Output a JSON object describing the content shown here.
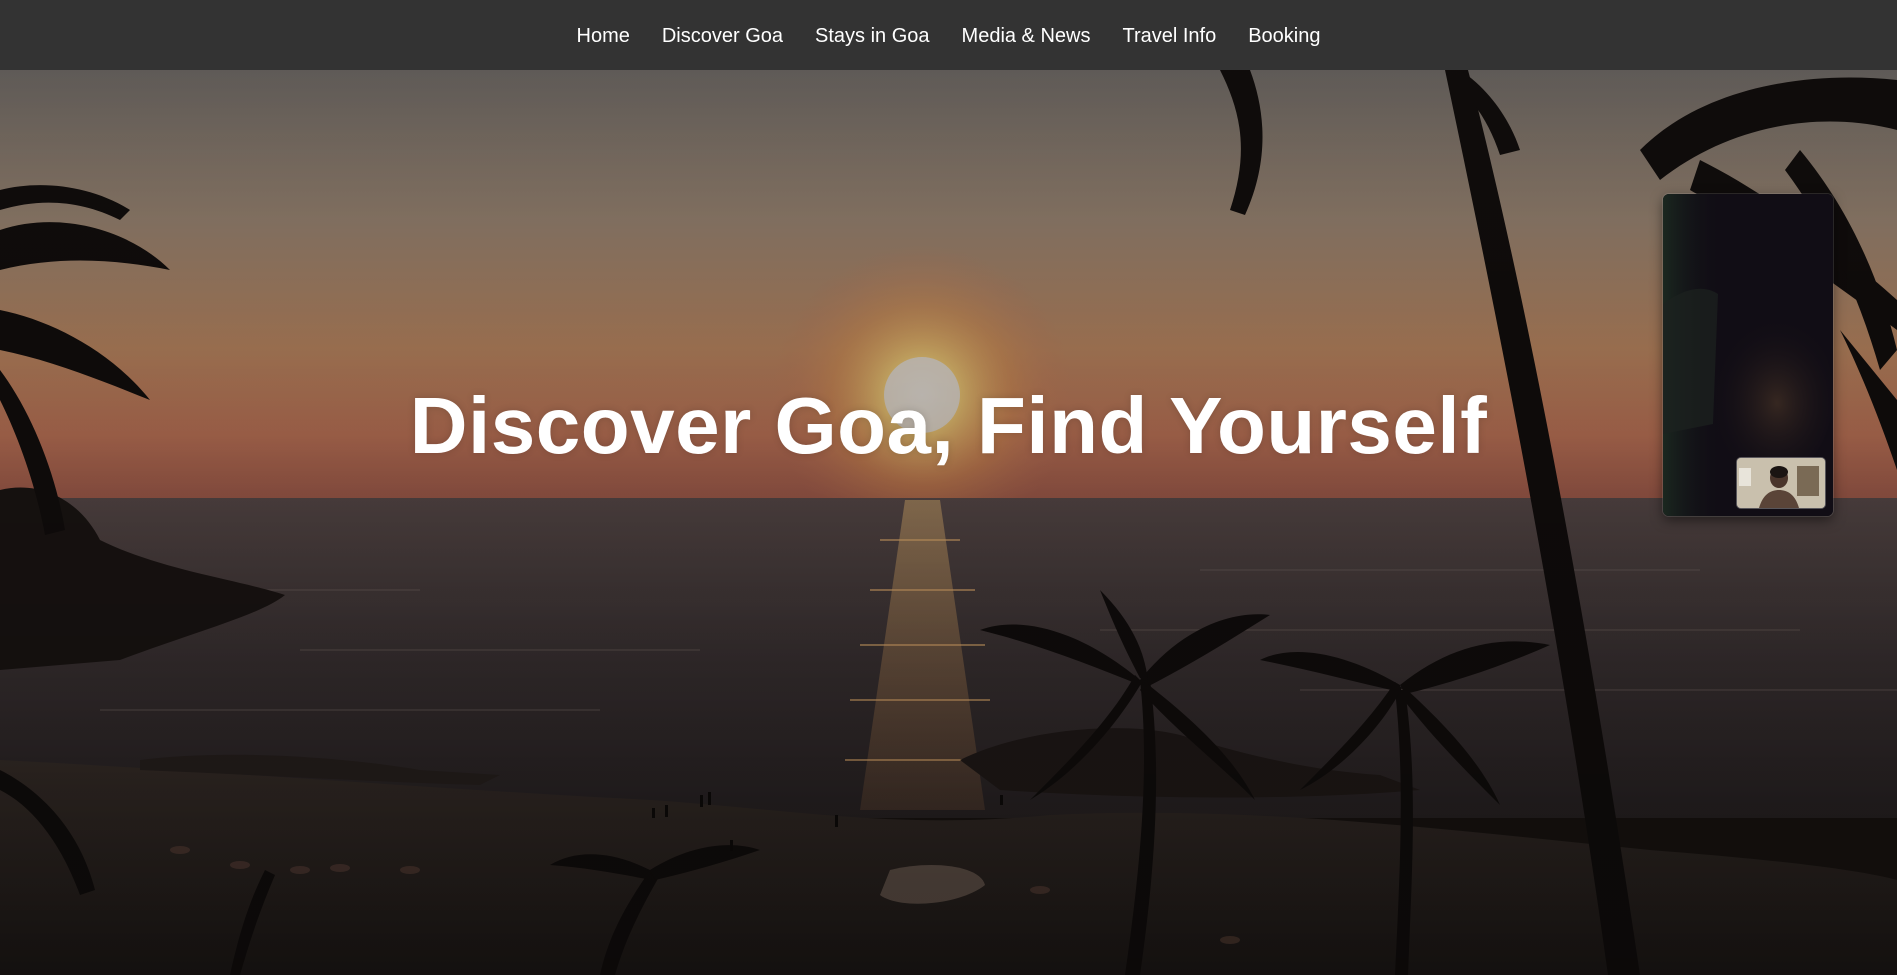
{
  "nav": {
    "items": [
      {
        "label": "Home"
      },
      {
        "label": "Discover Goa"
      },
      {
        "label": "Stays in Goa"
      },
      {
        "label": "Media & News"
      },
      {
        "label": "Travel Info"
      },
      {
        "label": "Booking"
      }
    ]
  },
  "hero": {
    "title": "Discover Goa, Find Yourself",
    "background": "sunset-beach-palms-image"
  },
  "video_call": {
    "remote_view": "remote-participant-video",
    "self_view": "self-view-video"
  },
  "colors": {
    "navbar_bg": "#333333",
    "nav_text": "#ffffff",
    "title_text": "#ffffff"
  }
}
